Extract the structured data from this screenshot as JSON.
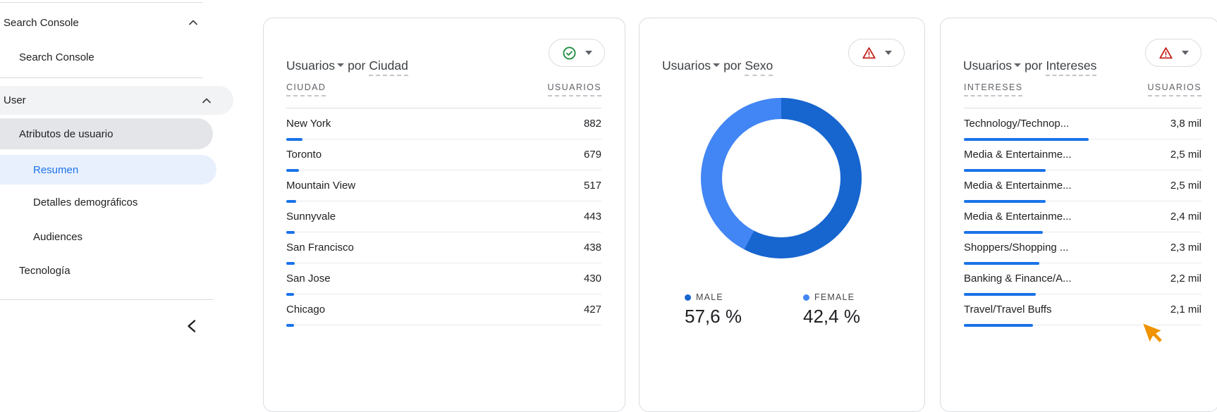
{
  "colors": {
    "accent_blue": "#1a73e8",
    "male_blue": "#1765cf",
    "female_blue": "#4285f4",
    "ok_green": "#1e8e3e",
    "warning_red": "#c5221f",
    "cursor_orange": "#f09300"
  },
  "sidebar": {
    "sections": [
      {
        "header": "Search Console",
        "collapse_icon": "chevron-up-icon"
      },
      {
        "header": "User",
        "collapse_icon": "chevron-up-icon"
      }
    ],
    "items": {
      "search_console_sub": "Search Console",
      "atributos": "Atributos de usuario",
      "resumen": "Resumen",
      "detalles": "Detalles demográficos",
      "audiences": "Audiences",
      "tecnologia": "Tecnología"
    },
    "selected_item": "Resumen",
    "collapse_button_icon": "chevron-left-icon"
  },
  "cards": [
    {
      "metric": "Usuarios",
      "connector": "por",
      "dimension": "Ciudad",
      "status_icon": "check-circle-icon",
      "columns": {
        "dim": "CIUDAD",
        "met": "USUARIOS"
      },
      "rows": [
        {
          "label": "New York",
          "value": "882",
          "bar": 23
        },
        {
          "label": "Toronto",
          "value": "679",
          "bar": 18
        },
        {
          "label": "Mountain View",
          "value": "517",
          "bar": 14
        },
        {
          "label": "Sunnyvale",
          "value": "443",
          "bar": 12
        },
        {
          "label": "San Francisco",
          "value": "438",
          "bar": 12
        },
        {
          "label": "San Jose",
          "value": "430",
          "bar": 11
        },
        {
          "label": "Chicago",
          "value": "427",
          "bar": 11
        }
      ]
    },
    {
      "metric": "Usuarios",
      "connector": "por",
      "dimension": "Sexo",
      "status_icon": "warning-triangle-icon",
      "donut": {
        "first_pct": 57.6,
        "first_color": "#1765cf",
        "second_color": "#4285f4"
      },
      "legend": [
        {
          "label": "MALE",
          "value": "57,6 %",
          "color": "#1765cf"
        },
        {
          "label": "FEMALE",
          "value": "42,4 %",
          "color": "#4285f4"
        }
      ]
    },
    {
      "metric": "Usuarios",
      "connector": "por",
      "dimension": "Intereses",
      "status_icon": "warning-triangle-icon",
      "columns": {
        "dim": "INTERESES",
        "met": "USUARIOS"
      },
      "rows": [
        {
          "label": "Technology/Technop...",
          "value": "3,8 mil",
          "bar": 177
        },
        {
          "label": "Media & Entertainme...",
          "value": "2,5 mil",
          "bar": 116
        },
        {
          "label": "Media & Entertainme...",
          "value": "2,5 mil",
          "bar": 116
        },
        {
          "label": "Media & Entertainme...",
          "value": "2,4 mil",
          "bar": 112
        },
        {
          "label": "Shoppers/Shopping ...",
          "value": "2,3 mil",
          "bar": 107
        },
        {
          "label": "Banking & Finance/A...",
          "value": "2,2 mil",
          "bar": 102
        },
        {
          "label": "Travel/Travel Buffs",
          "value": "2,1 mil",
          "bar": 98
        }
      ]
    }
  ],
  "chart_data": [
    {
      "type": "table",
      "title": "Usuarios por Ciudad",
      "xlabel": "CIUDAD",
      "ylabel": "USUARIOS",
      "categories": [
        "New York",
        "Toronto",
        "Mountain View",
        "Sunnyvale",
        "San Francisco",
        "San Jose",
        "Chicago"
      ],
      "values": [
        882,
        679,
        517,
        443,
        438,
        430,
        427
      ],
      "bar_color": "#1a73e8"
    },
    {
      "type": "pie",
      "title": "Usuarios por Sexo",
      "categories": [
        "MALE",
        "FEMALE"
      ],
      "values": [
        57.6,
        42.4
      ],
      "value_labels": [
        "57,6 %",
        "42,4 %"
      ],
      "colors": [
        "#1765cf",
        "#4285f4"
      ],
      "donut": true,
      "start_angle": "top",
      "direction": "clockwise",
      "legend_position": "bottom"
    },
    {
      "type": "table",
      "title": "Usuarios por Intereses",
      "xlabel": "INTERESES",
      "ylabel": "USUARIOS",
      "categories": [
        "Technology/Technop...",
        "Media & Entertainme...",
        "Media & Entertainme...",
        "Media & Entertainme...",
        "Shoppers/Shopping ...",
        "Banking & Finance/A...",
        "Travel/Travel Buffs"
      ],
      "values": [
        3800,
        2500,
        2500,
        2400,
        2300,
        2200,
        2100
      ],
      "value_labels": [
        "3,8 mil",
        "2,5 mil",
        "2,5 mil",
        "2,4 mil",
        "2,3 mil",
        "2,2 mil",
        "2,1 mil"
      ],
      "bar_color": "#1a73e8"
    }
  ]
}
